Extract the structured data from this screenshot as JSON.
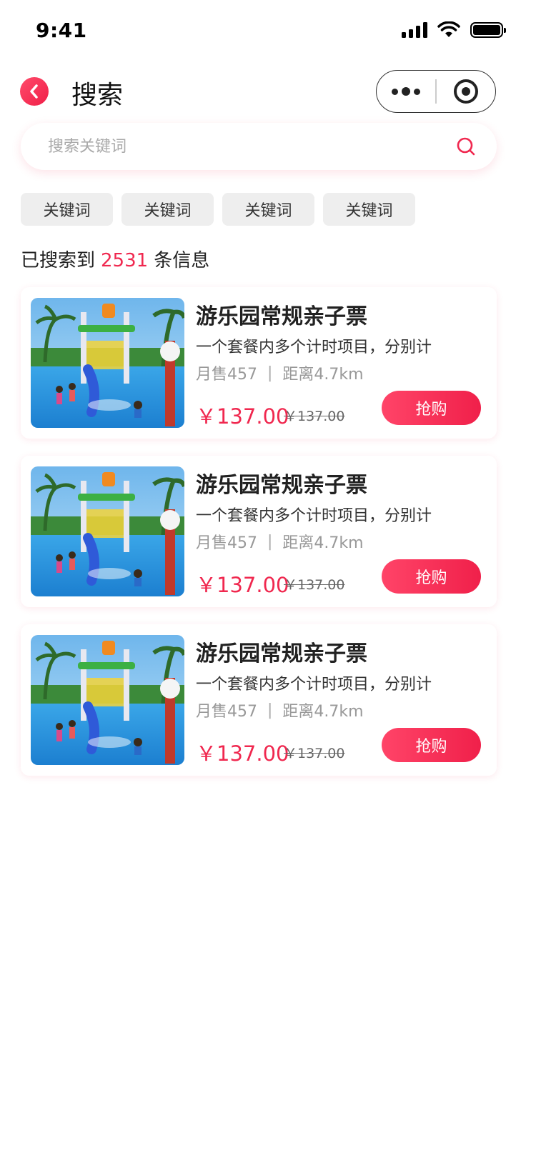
{
  "status_bar": {
    "time": "9:41"
  },
  "nav": {
    "title": "搜索"
  },
  "search": {
    "placeholder": "搜索关键词",
    "value": ""
  },
  "keywords": [
    "关键词",
    "关键词",
    "关键词",
    "关键词"
  ],
  "results": {
    "prefix": "已搜索到",
    "count": "2531",
    "suffix": "条信息"
  },
  "colors": {
    "accent": "#f0284f",
    "chip_bg": "#eeeeee",
    "text_primary": "#222222",
    "text_muted": "#999999"
  },
  "products": [
    {
      "title": "游乐园常规亲子票",
      "desc": "一个套餐内多个计时项目，分别计",
      "sales": "月售457",
      "distance": "距离4.7km",
      "price": "￥137.00",
      "original_price": "￥137.00",
      "buy_label": "抢购"
    },
    {
      "title": "游乐园常规亲子票",
      "desc": "一个套餐内多个计时项目，分别计",
      "sales": "月售457",
      "distance": "距离4.7km",
      "price": "￥137.00",
      "original_price": "￥137.00",
      "buy_label": "抢购"
    },
    {
      "title": "游乐园常规亲子票",
      "desc": "一个套餐内多个计时项目，分别计",
      "sales": "月售457",
      "distance": "距离4.7km",
      "price": "￥137.00",
      "original_price": "￥137.00",
      "buy_label": "抢购"
    }
  ]
}
